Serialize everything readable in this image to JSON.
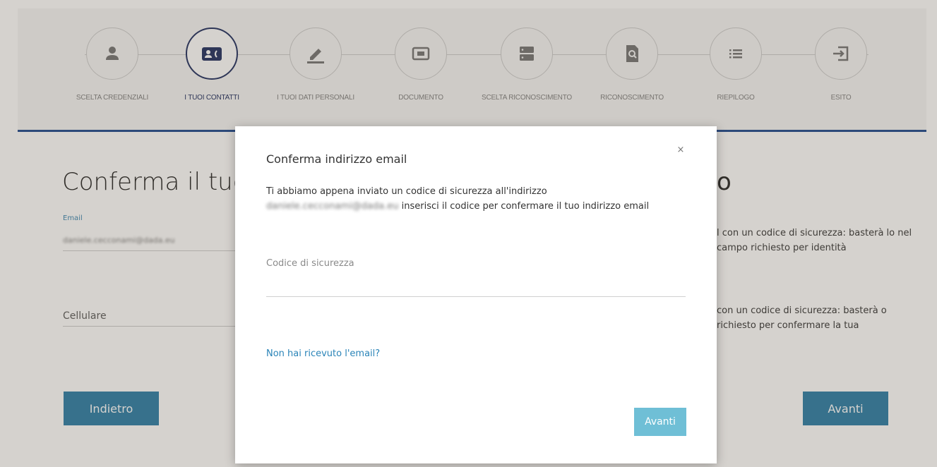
{
  "steps": [
    {
      "label": "SCELTA CREDENZIALI",
      "icon": "user-icon",
      "active": false
    },
    {
      "label": "I TUOI CONTATTI",
      "icon": "contact-card-icon",
      "active": true
    },
    {
      "label": "I TUOI DATI PERSONALI",
      "icon": "pencil-icon",
      "active": false
    },
    {
      "label": "DOCUMENTO",
      "icon": "document-frame-icon",
      "active": false
    },
    {
      "label": "SCELTA RICONOSCIMENTO",
      "icon": "server-icon",
      "active": false
    },
    {
      "label": "RICONOSCIMENTO",
      "icon": "document-search-icon",
      "active": false
    },
    {
      "label": "RIEPILOGO",
      "icon": "list-icon",
      "active": false
    },
    {
      "label": "ESITO",
      "icon": "sign-in-icon",
      "active": false
    }
  ],
  "page": {
    "title": "Conferma il tuo",
    "title_right": "o",
    "email_label": "Email",
    "email_value": "daniele.cecconami@dada.eu",
    "cell_label": "Cellulare",
    "right_text_1": "l con un codice di sicurezza: basterà lo nel campo richiesto per identità",
    "right_text_2": "con un codice di sicurezza: basterà o richiesto per confermare la tua",
    "back_button": "Indietro",
    "next_button": "Avanti"
  },
  "modal": {
    "title": "Conferma indirizzo email",
    "close": "×",
    "text_part1": "Ti abbiamo appena inviato un codice di sicurezza all'indirizzo",
    "email": "daniele.cecconami@dada.eu",
    "text_part2": " inserisci il codice per confermare il tuo indirizzo email",
    "security_label": "Codice di sicurezza",
    "security_value": "",
    "resend_link": "Non hai ricevuto l'email?",
    "next_button": "Avanti"
  },
  "colors": {
    "accent_navy": "#2f3d6b",
    "rule_blue": "#2e5597",
    "button_blue": "#3a86ad",
    "modal_button": "#6fbfd6",
    "link": "#2a84b8"
  }
}
